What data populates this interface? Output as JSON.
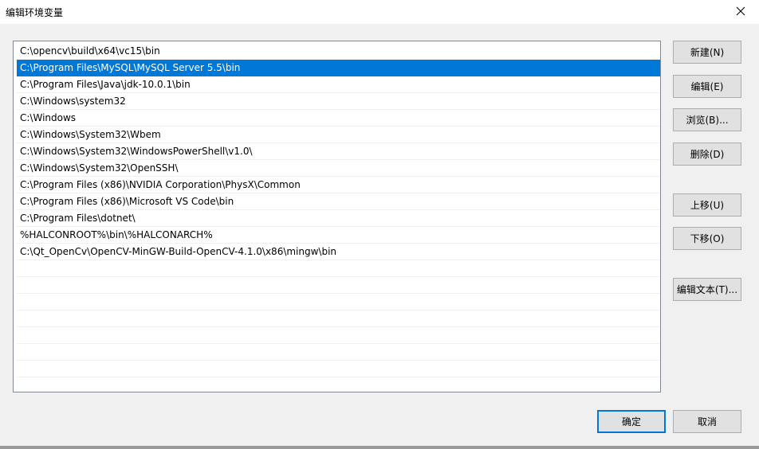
{
  "window": {
    "title": "编辑环境变量",
    "close_icon": "close-icon"
  },
  "paths": [
    "C:\\opencv\\build\\x64\\vc15\\bin",
    "C:\\Program Files\\MySQL\\MySQL Server 5.5\\bin",
    "C:\\Program Files\\Java\\jdk-10.0.1\\bin",
    "C:\\Windows\\system32",
    "C:\\Windows",
    "C:\\Windows\\System32\\Wbem",
    "C:\\Windows\\System32\\WindowsPowerShell\\v1.0\\",
    "C:\\Windows\\System32\\OpenSSH\\",
    "C:\\Program Files (x86)\\NVIDIA Corporation\\PhysX\\Common",
    "C:\\Program Files (x86)\\Microsoft VS Code\\bin",
    "C:\\Program Files\\dotnet\\",
    "%HALCONROOT%\\bin\\%HALCONARCH%",
    "C:\\Qt_OpenCv\\OpenCV-MinGW-Build-OpenCV-4.1.0\\x86\\mingw\\bin",
    "",
    "",
    "",
    "",
    "",
    "",
    "",
    ""
  ],
  "selected_index": 1,
  "buttons": {
    "new": "新建(N)",
    "edit": "编辑(E)",
    "browse": "浏览(B)...",
    "delete": "删除(D)",
    "move_up": "上移(U)",
    "move_down": "下移(O)",
    "edit_text": "编辑文本(T)...",
    "ok": "确定",
    "cancel": "取消"
  },
  "colors": {
    "selection": "#0078d7",
    "background": "#f0f0f0"
  }
}
